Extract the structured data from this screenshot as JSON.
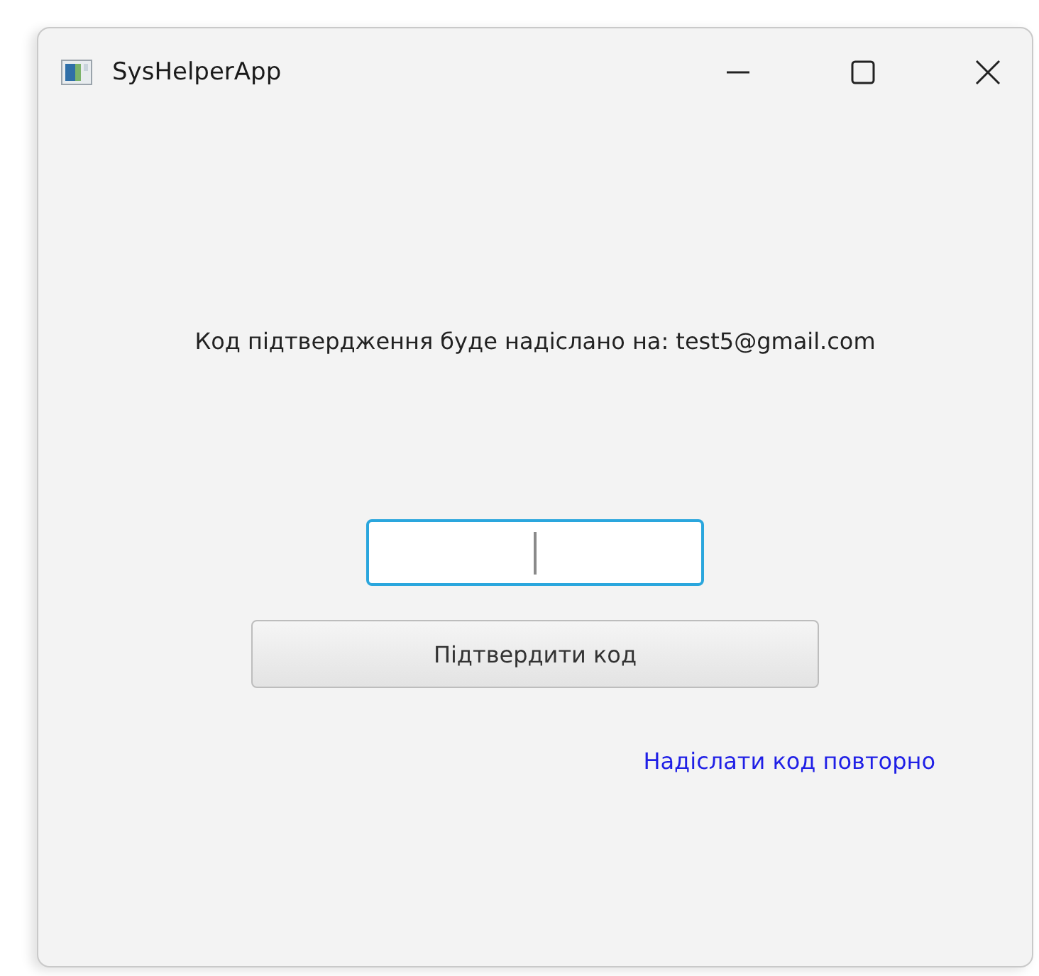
{
  "window": {
    "title": "SysHelperApp"
  },
  "message": "Код підтвердження буде надіслано на: test5@gmail.com",
  "code_field": {
    "focused": true
  },
  "confirm_button": "Підтвердити код",
  "resend_link": "Надіслати код повторно"
}
